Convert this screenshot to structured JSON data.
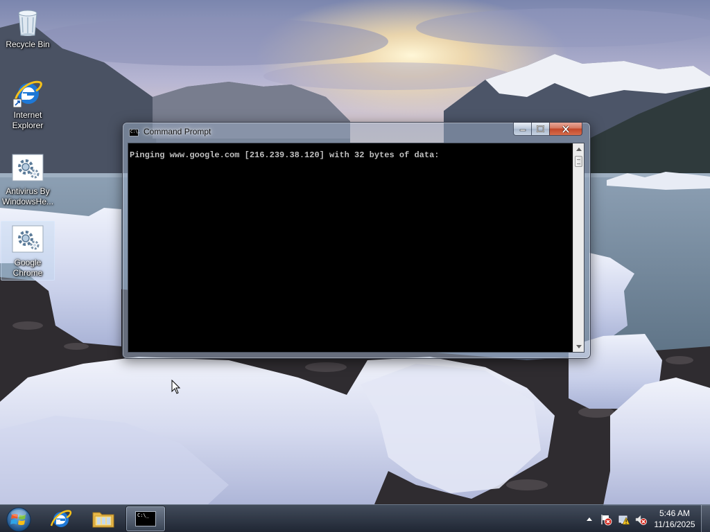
{
  "desktop": {
    "icons": [
      {
        "label": "Recycle Bin",
        "icon": "recycle-bin-icon",
        "selected": false
      },
      {
        "label": "Internet Explorer",
        "icon": "internet-explorer-icon",
        "selected": false
      },
      {
        "label": "Antivirus By WindowsHe...",
        "icon": "settings-gear-icon",
        "selected": false
      },
      {
        "label": "Google Chrome",
        "icon": "settings-gear-icon",
        "selected": true
      }
    ]
  },
  "window": {
    "title": "Command Prompt",
    "title_icon_text": "C:\\.",
    "output": "Pinging www.google.com [216.239.38.120] with 32 bytes of data:",
    "buttons": {
      "minimize": "minimize-icon",
      "maximize": "maximize-icon",
      "close": "close-icon"
    }
  },
  "taskbar": {
    "start": "windows-start-orb-icon",
    "pinned": [
      "internet-explorer-icon",
      "file-explorer-folder-icon"
    ],
    "active_app_icon_text": "C:\\_",
    "tray": [
      "show-hidden-icons-chevron",
      "action-center-flag-icon",
      "network-icon",
      "volume-muted-icon"
    ],
    "clock": {
      "time": "5:46 AM",
      "date": "11/16/2025"
    }
  },
  "colors": {
    "console_bg": "#000000",
    "console_text": "#c0c0c0",
    "close_button": "#c2472a",
    "taskbar": "#2a3446"
  }
}
